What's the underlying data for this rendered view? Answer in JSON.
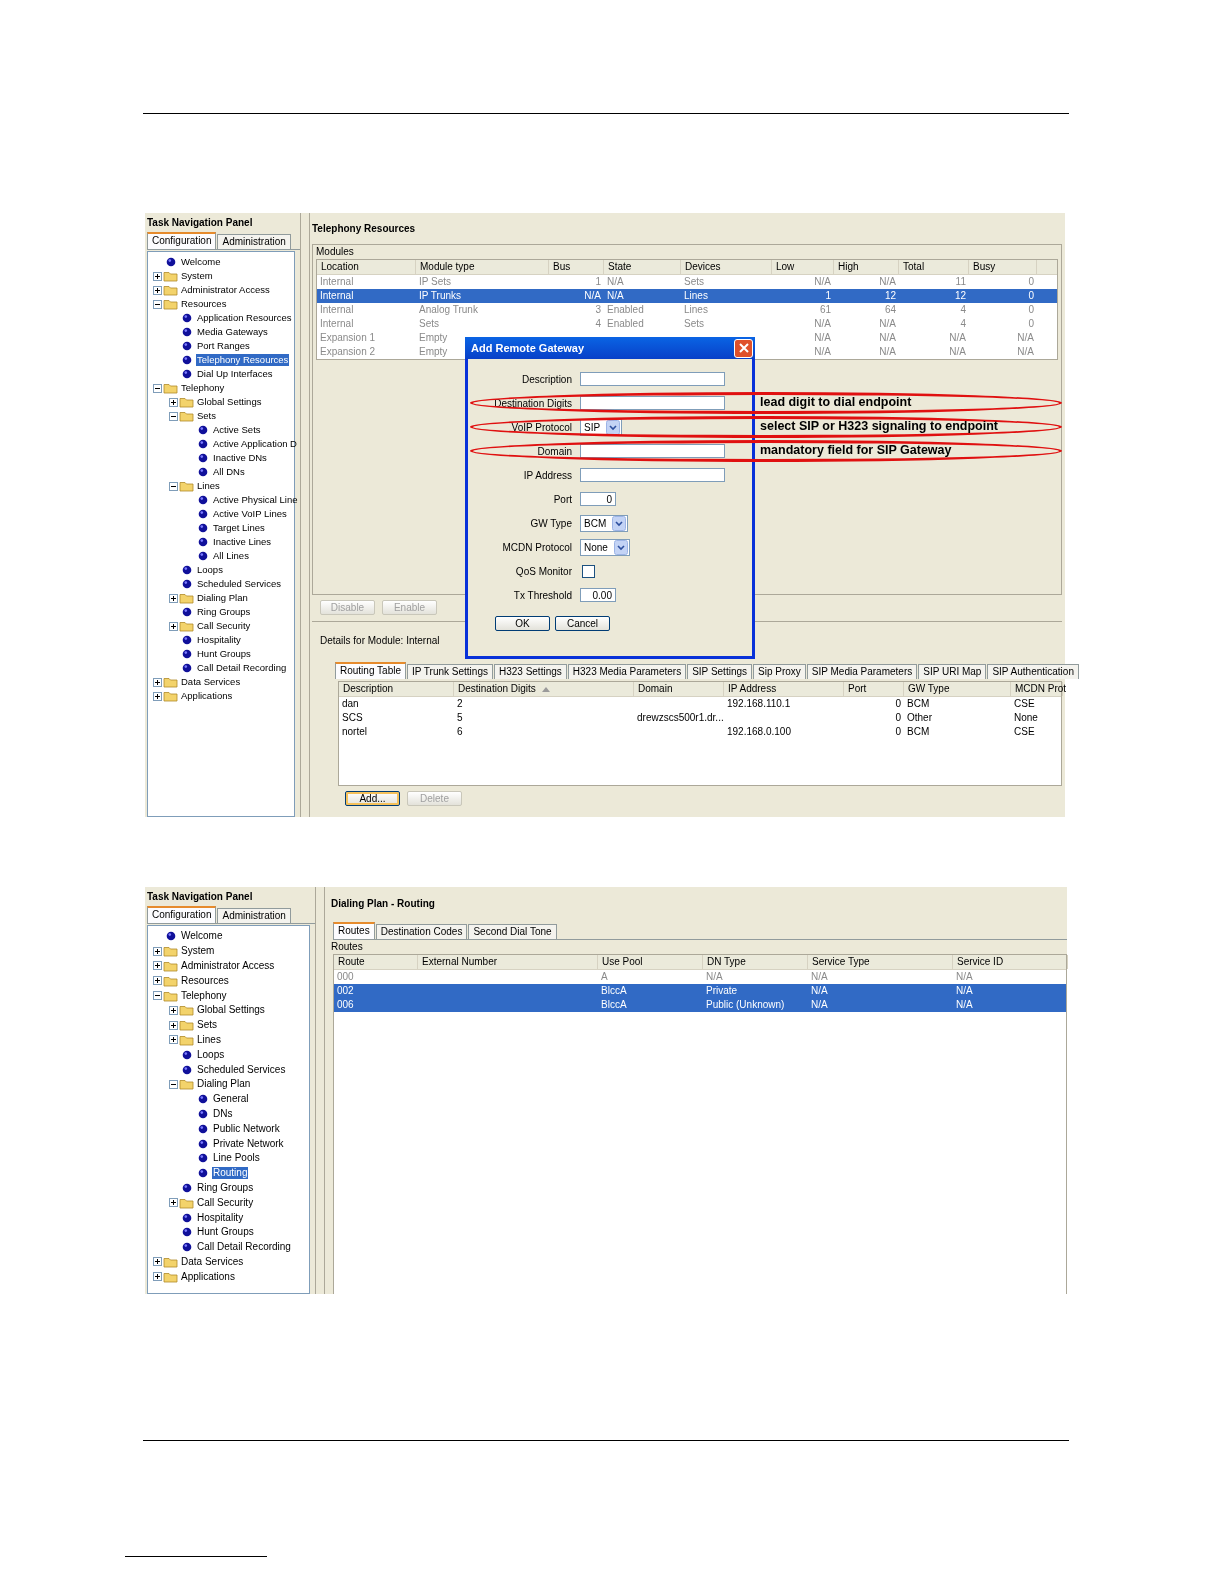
{
  "telephony_resources_screen": {
    "nav": {
      "title": "Task Navigation Panel",
      "tabs": [
        {
          "label": "Configuration",
          "selected": true
        },
        {
          "label": "Administration",
          "selected": false
        }
      ],
      "tree": [
        {
          "label": "Welcome",
          "kind": "leaf",
          "selected": false
        },
        {
          "label": "System",
          "kind": "folder",
          "expanded": false,
          "selected": false
        },
        {
          "label": "Administrator Access",
          "kind": "folder",
          "expanded": false,
          "selected": false
        },
        {
          "label": "Resources",
          "kind": "folder",
          "expanded": true,
          "selected": false,
          "children": [
            {
              "label": "Application Resources",
              "kind": "leaf",
              "selected": false
            },
            {
              "label": "Media Gateways",
              "kind": "leaf",
              "selected": false
            },
            {
              "label": "Port Ranges",
              "kind": "leaf",
              "selected": false
            },
            {
              "label": "Telephony Resources",
              "kind": "leaf",
              "selected": true
            },
            {
              "label": "Dial Up Interfaces",
              "kind": "leaf",
              "selected": false
            }
          ]
        },
        {
          "label": "Telephony",
          "kind": "folder",
          "expanded": true,
          "selected": false,
          "children": [
            {
              "label": "Global Settings",
              "kind": "folder",
              "expanded": false,
              "selected": false
            },
            {
              "label": "Sets",
              "kind": "folder",
              "expanded": true,
              "selected": false,
              "children": [
                {
                  "label": "Active Sets",
                  "kind": "leaf",
                  "selected": false
                },
                {
                  "label": "Active Application D",
                  "kind": "leaf",
                  "selected": false
                },
                {
                  "label": "Inactive DNs",
                  "kind": "leaf",
                  "selected": false
                },
                {
                  "label": "All DNs",
                  "kind": "leaf",
                  "selected": false
                }
              ]
            },
            {
              "label": "Lines",
              "kind": "folder",
              "expanded": true,
              "selected": false,
              "children": [
                {
                  "label": "Active Physical Line",
                  "kind": "leaf",
                  "selected": false
                },
                {
                  "label": "Active VoIP Lines",
                  "kind": "leaf",
                  "selected": false
                },
                {
                  "label": "Target Lines",
                  "kind": "leaf",
                  "selected": false
                },
                {
                  "label": "Inactive Lines",
                  "kind": "leaf",
                  "selected": false
                },
                {
                  "label": "All Lines",
                  "kind": "leaf",
                  "selected": false
                }
              ]
            },
            {
              "label": "Loops",
              "kind": "leaf",
              "selected": false
            },
            {
              "label": "Scheduled Services",
              "kind": "leaf",
              "selected": false
            },
            {
              "label": "Dialing Plan",
              "kind": "folder",
              "expanded": false,
              "selected": false
            },
            {
              "label": "Ring Groups",
              "kind": "leaf",
              "selected": false
            },
            {
              "label": "Call Security",
              "kind": "folder",
              "expanded": false,
              "selected": false
            },
            {
              "label": "Hospitality",
              "kind": "leaf",
              "selected": false
            },
            {
              "label": "Hunt Groups",
              "kind": "leaf",
              "selected": false
            },
            {
              "label": "Call Detail Recording",
              "kind": "leaf",
              "selected": false
            }
          ]
        },
        {
          "label": "Data Services",
          "kind": "folder",
          "expanded": false,
          "selected": false
        },
        {
          "label": "Applications",
          "kind": "folder",
          "expanded": false,
          "selected": false
        }
      ]
    },
    "panel_title": "Telephony Resources",
    "modules": {
      "label": "Modules",
      "columns": [
        "Location",
        "Module type",
        "Bus",
        "State",
        "Devices",
        "Low",
        "High",
        "Total",
        "Busy"
      ],
      "rows": [
        {
          "cells": [
            "Internal",
            "IP Sets",
            "1",
            "N/A",
            "Sets",
            "N/A",
            "N/A",
            "11",
            "0"
          ],
          "selected": false
        },
        {
          "cells": [
            "Internal",
            "IP Trunks",
            "N/A",
            "N/A",
            "Lines",
            "1",
            "12",
            "12",
            "0"
          ],
          "selected": true
        },
        {
          "cells": [
            "Internal",
            "Analog Trunk",
            "3",
            "Enabled",
            "Lines",
            "61",
            "64",
            "4",
            "0"
          ],
          "selected": false
        },
        {
          "cells": [
            "Internal",
            "Sets",
            "4",
            "Enabled",
            "Sets",
            "N/A",
            "N/A",
            "4",
            "0"
          ],
          "selected": false
        },
        {
          "cells": [
            "Expansion 1",
            "Empty",
            "",
            "",
            "",
            "N/A",
            "N/A",
            "N/A",
            "N/A"
          ],
          "selected": false
        },
        {
          "cells": [
            "Expansion 2",
            "Empty",
            "",
            "",
            "",
            "N/A",
            "N/A",
            "N/A",
            "N/A"
          ],
          "selected": false
        }
      ]
    },
    "module_buttons": [
      {
        "label": "Disable",
        "disabled": true
      },
      {
        "label": "Enable",
        "disabled": true
      }
    ],
    "details": {
      "label": "Details for Module: Internal",
      "tabs": [
        {
          "label": "Routing Table",
          "selected": true
        },
        {
          "label": "IP Trunk Settings",
          "selected": false
        },
        {
          "label": "H323 Settings",
          "selected": false
        },
        {
          "label": "H323 Media Parameters",
          "selected": false
        },
        {
          "label": "SIP Settings",
          "selected": false
        },
        {
          "label": "Sip Proxy",
          "selected": false
        },
        {
          "label": "SIP Media Parameters",
          "selected": false
        },
        {
          "label": "SIP URI Map",
          "selected": false
        },
        {
          "label": "SIP Authentication",
          "selected": false
        }
      ],
      "columns": [
        {
          "label": "Description",
          "sorted": false
        },
        {
          "label": "Destination Digits",
          "sorted": true
        },
        {
          "label": "Domain",
          "sorted": false
        },
        {
          "label": "IP Address",
          "sorted": false
        },
        {
          "label": "Port",
          "sorted": false
        },
        {
          "label": "GW Type",
          "sorted": false
        },
        {
          "label": "MCDN Prot",
          "sorted": false
        }
      ],
      "rows": [
        {
          "cells": [
            "dan",
            "2",
            "",
            "192.168.110.1",
            "0",
            "BCM",
            "CSE"
          ],
          "selected": false
        },
        {
          "cells": [
            "SCS",
            "5",
            "drewzscs500r1.dr...",
            "",
            "0",
            "Other",
            "None"
          ],
          "selected": false
        },
        {
          "cells": [
            "nortel",
            "6",
            "",
            "192.168.0.100",
            "0",
            "BCM",
            "CSE"
          ],
          "selected": false
        }
      ],
      "buttons": [
        {
          "label": "Add...",
          "disabled": false,
          "focused": true
        },
        {
          "label": "Delete",
          "disabled": true,
          "focused": false
        }
      ]
    },
    "dialog": {
      "title": "Add Remote Gateway",
      "fields": [
        {
          "label": "Description",
          "kind": "text"
        },
        {
          "label": "Destination Digits",
          "kind": "text",
          "annotation": "lead digit to dial endpoint"
        },
        {
          "label": "VoIP Protocol",
          "kind": "select",
          "value": "SIP",
          "annotation": "select SIP or H323 signaling to endpoint"
        },
        {
          "label": "Domain",
          "kind": "text",
          "annotation": "mandatory field for SIP Gateway"
        },
        {
          "label": "IP Address",
          "kind": "text"
        },
        {
          "label": "Port",
          "kind": "short_text",
          "value": "0"
        },
        {
          "label": "GW Type",
          "kind": "select",
          "value": "BCM"
        },
        {
          "label": "MCDN Protocol",
          "kind": "select",
          "value": "None"
        },
        {
          "label": "QoS Monitor",
          "kind": "checkbox",
          "checked": false
        },
        {
          "label": "Tx Threshold",
          "kind": "short_text",
          "value": "0.00"
        }
      ],
      "buttons": [
        "OK",
        "Cancel"
      ]
    }
  },
  "routing_screen": {
    "nav": {
      "title": "Task Navigation Panel",
      "tabs": [
        {
          "label": "Configuration",
          "selected": true
        },
        {
          "label": "Administration",
          "selected": false
        }
      ],
      "tree": [
        {
          "label": "Welcome",
          "kind": "leaf",
          "selected": false
        },
        {
          "label": "System",
          "kind": "folder",
          "expanded": false,
          "selected": false
        },
        {
          "label": "Administrator Access",
          "kind": "folder",
          "expanded": false,
          "selected": false
        },
        {
          "label": "Resources",
          "kind": "folder",
          "expanded": false,
          "selected": false
        },
        {
          "label": "Telephony",
          "kind": "folder",
          "expanded": true,
          "selected": false,
          "children": [
            {
              "label": "Global Settings",
              "kind": "folder",
              "expanded": false,
              "selected": false
            },
            {
              "label": "Sets",
              "kind": "folder",
              "expanded": false,
              "selected": false
            },
            {
              "label": "Lines",
              "kind": "folder",
              "expanded": false,
              "selected": false
            },
            {
              "label": "Loops",
              "kind": "leaf",
              "selected": false
            },
            {
              "label": "Scheduled Services",
              "kind": "leaf",
              "selected": false
            },
            {
              "label": "Dialing Plan",
              "kind": "folder",
              "expanded": true,
              "selected": false,
              "children": [
                {
                  "label": "General",
                  "kind": "leaf",
                  "selected": false
                },
                {
                  "label": "DNs",
                  "kind": "leaf",
                  "selected": false
                },
                {
                  "label": "Public Network",
                  "kind": "leaf",
                  "selected": false
                },
                {
                  "label": "Private Network",
                  "kind": "leaf",
                  "selected": false
                },
                {
                  "label": "Line Pools",
                  "kind": "leaf",
                  "selected": false
                },
                {
                  "label": "Routing",
                  "kind": "leaf",
                  "selected": true
                }
              ]
            },
            {
              "label": "Ring Groups",
              "kind": "leaf",
              "selected": false
            },
            {
              "label": "Call Security",
              "kind": "folder",
              "expanded": false,
              "selected": false
            },
            {
              "label": "Hospitality",
              "kind": "leaf",
              "selected": false
            },
            {
              "label": "Hunt Groups",
              "kind": "leaf",
              "selected": false
            },
            {
              "label": "Call Detail Recording",
              "kind": "leaf",
              "selected": false
            }
          ]
        },
        {
          "label": "Data Services",
          "kind": "folder",
          "expanded": false,
          "selected": false
        },
        {
          "label": "Applications",
          "kind": "folder",
          "expanded": false,
          "selected": false
        }
      ]
    },
    "panel_title": "Dialing Plan - Routing",
    "tabs": [
      {
        "label": "Routes",
        "selected": true
      },
      {
        "label": "Destination Codes",
        "selected": false
      },
      {
        "label": "Second Dial Tone",
        "selected": false
      }
    ],
    "routes": {
      "label": "Routes",
      "columns": [
        "Route",
        "External Number",
        "Use Pool",
        "DN Type",
        "Service Type",
        "Service ID"
      ],
      "rows": [
        {
          "cells": [
            "000",
            "",
            "A",
            "N/A",
            "N/A",
            "N/A"
          ],
          "selected": false
        },
        {
          "cells": [
            "002",
            "",
            "BlccA",
            "Private",
            "N/A",
            "N/A"
          ],
          "selected": true
        },
        {
          "cells": [
            "006",
            "",
            "BlccA",
            "Public (Unknown)",
            "N/A",
            "N/A"
          ],
          "selected": true
        }
      ]
    }
  }
}
